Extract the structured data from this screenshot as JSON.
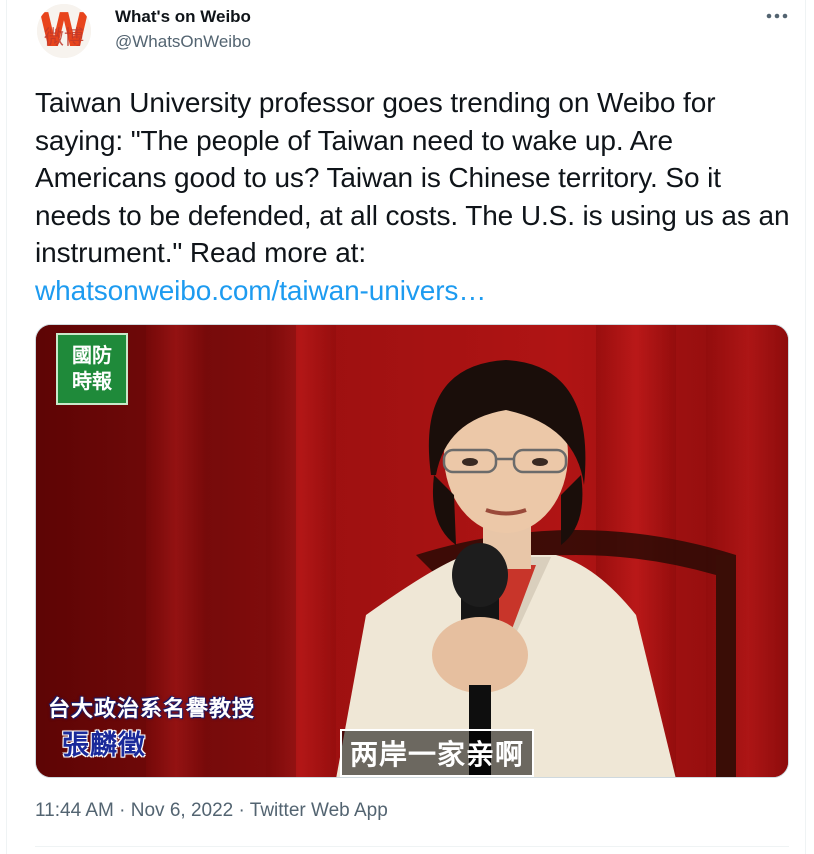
{
  "author": {
    "display_name": "What's on Weibo",
    "handle": "@WhatsOnWeibo",
    "avatar_letter": "W",
    "avatar_overlay_text": "微博",
    "avatar_color": "#e8441c"
  },
  "tweet": {
    "text": "Taiwan University professor goes trending on Weibo for saying: \"The people of Taiwan need to wake up. Are Americans good to us? Taiwan is Chinese territory. So it needs to be defended, at all costs. The U.S. is using us as an instrument.\" Read more at:",
    "link_text": "whatsonweibo.com/taiwan-univers…",
    "link_color": "#1d9bf0"
  },
  "media": {
    "logo_line1": "國防",
    "logo_line2": "時報",
    "caption_line1": "台大政治系名譽教授",
    "caption_line2": "張麟徵",
    "subtitle": "两岸一家亲啊"
  },
  "meta": {
    "time": "11:44 AM",
    "separator": "·",
    "date": "Nov 6, 2022",
    "source": "Twitter Web App"
  },
  "icons": {
    "more": "more-horizontal-icon"
  }
}
